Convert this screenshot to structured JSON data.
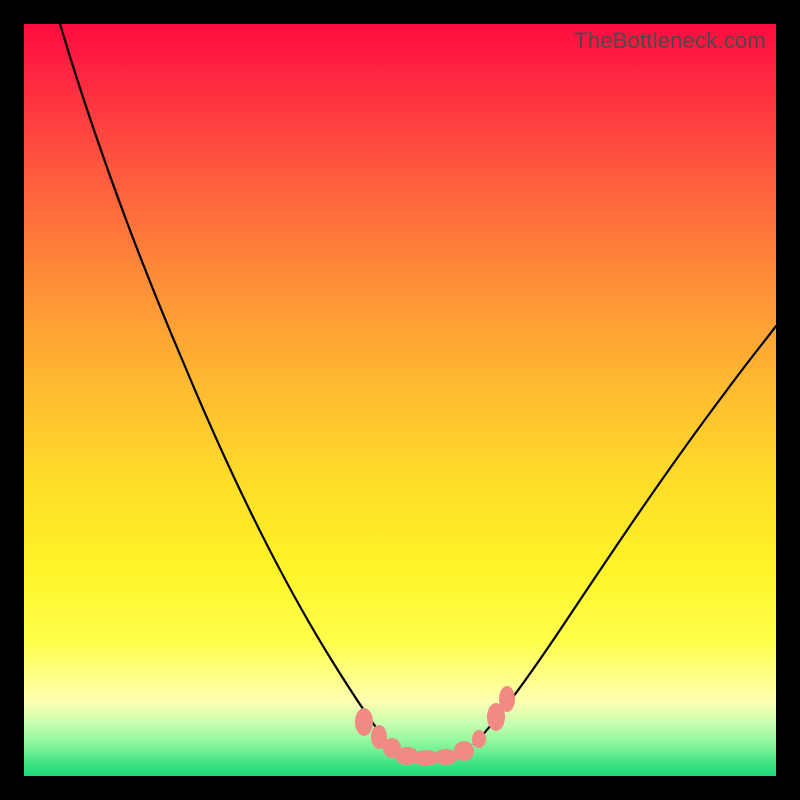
{
  "watermark": {
    "text": "TheBottleneck.com"
  },
  "chart_data": {
    "type": "line",
    "title": "",
    "xlabel": "",
    "ylabel": "",
    "xlim": [
      0,
      100
    ],
    "ylim": [
      0,
      100
    ],
    "series": [
      {
        "name": "left-curve",
        "x": [
          5,
          10,
          15,
          20,
          25,
          30,
          35,
          40,
          45,
          48
        ],
        "values": [
          100,
          82,
          66,
          52,
          40,
          29,
          20,
          12,
          6,
          3
        ]
      },
      {
        "name": "right-curve",
        "x": [
          60,
          65,
          70,
          75,
          80,
          85,
          90,
          95,
          100
        ],
        "values": [
          4,
          9,
          15,
          22,
          29,
          36,
          44,
          52,
          60
        ]
      },
      {
        "name": "bottom-flat",
        "x": [
          48,
          50,
          52,
          54,
          56,
          58,
          60
        ],
        "values": [
          3,
          2,
          2,
          2,
          2,
          3,
          4
        ]
      }
    ],
    "markers": {
      "name": "highlight-points",
      "x": [
        44.5,
        46.5,
        48,
        50,
        52,
        54,
        56,
        58.5,
        60,
        61.5,
        63
      ],
      "values": [
        7,
        5,
        3.5,
        2.5,
        2.3,
        2.3,
        2.5,
        3.5,
        5,
        7,
        8.5
      ]
    },
    "gradient_stops": [
      {
        "pos": 0,
        "color": "#ff0b3f"
      },
      {
        "pos": 33,
        "color": "#ff8a39"
      },
      {
        "pos": 72,
        "color": "#fff326"
      },
      {
        "pos": 100,
        "color": "#18db76"
      }
    ]
  }
}
